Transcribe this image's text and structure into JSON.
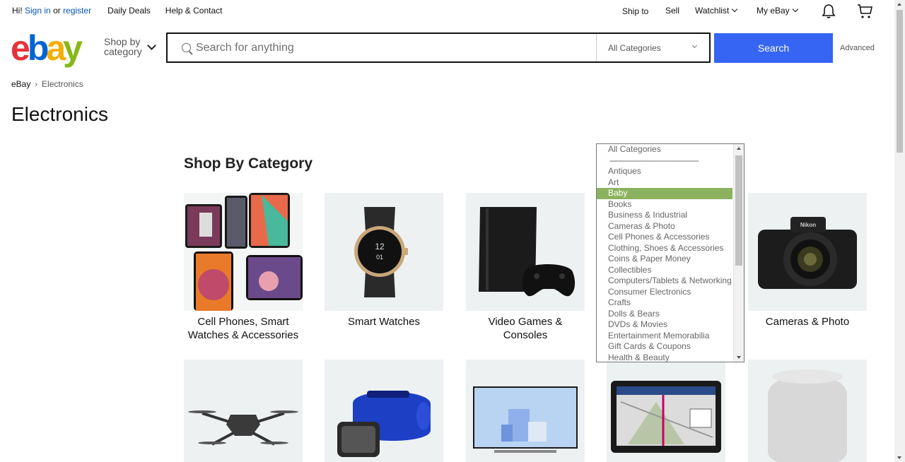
{
  "topbar": {
    "greeting": "Hi!",
    "sign_in": "Sign in",
    "or": "or",
    "register": "register",
    "daily_deals": "Daily Deals",
    "help_contact": "Help & Contact",
    "ship_to": "Ship to",
    "sell": "Sell",
    "watchlist": "Watchlist",
    "my_ebay": "My eBay"
  },
  "header": {
    "logo": [
      "e",
      "b",
      "a",
      "y"
    ],
    "shop_by_line1": "Shop by",
    "shop_by_line2": "category",
    "search_placeholder": "Search for anything",
    "category_selected": "All Categories",
    "search_button": "Search",
    "advanced": "Advanced"
  },
  "breadcrumb": {
    "home": "eBay",
    "current": "Electronics"
  },
  "page_title": "Electronics",
  "section_title": "Shop By Category",
  "tiles": [
    {
      "label": "Cell Phones, Smart Watches & Accessories",
      "icon": "phones-image"
    },
    {
      "label": "Smart Watches",
      "icon": "smartwatch-image"
    },
    {
      "label": "Video Games & Consoles",
      "icon": "console-image"
    },
    {
      "label": "",
      "icon": "hidden-tile"
    },
    {
      "label": "Cameras & Photo",
      "icon": "camera-image"
    },
    {
      "label": "",
      "icon": "drone-image"
    },
    {
      "label": "",
      "icon": "speaker-image"
    },
    {
      "label": "",
      "icon": "tv-image"
    },
    {
      "label": "",
      "icon": "gps-image"
    },
    {
      "label": "",
      "icon": "homepod-image"
    }
  ],
  "dropdown": {
    "items": [
      "All Categories",
      "------------------------------------------",
      "Antiques",
      "Art",
      "Baby",
      "Books",
      "Business & Industrial",
      "Cameras & Photo",
      "Cell Phones & Accessories",
      "Clothing, Shoes & Accessories",
      "Coins & Paper Money",
      "Collectibles",
      "Computers/Tablets & Networking",
      "Consumer Electronics",
      "Crafts",
      "Dolls & Bears",
      "DVDs & Movies",
      "Entertainment Memorabilia",
      "Gift Cards & Coupons",
      "Health & Beauty"
    ],
    "highlighted": "Baby"
  },
  "colors": {
    "logo_e": "#e53238",
    "logo_b": "#0064d2",
    "logo_a": "#f5af02",
    "logo_y": "#86b817",
    "search_button": "#3665f3",
    "highlight": "#8db25f",
    "link": "#0654ba"
  }
}
